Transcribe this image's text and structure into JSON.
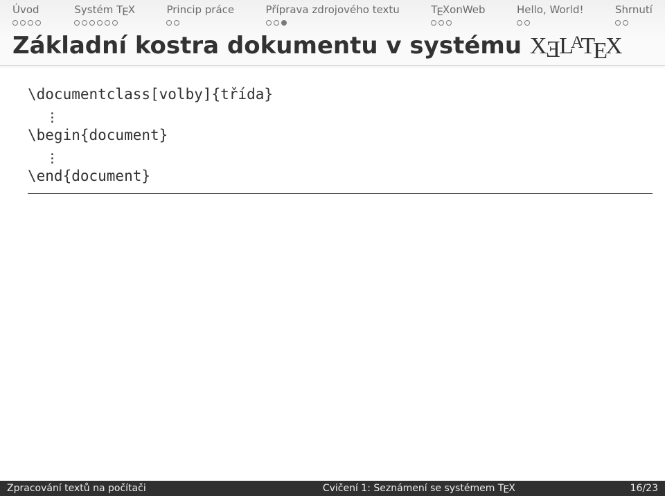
{
  "nav": {
    "items": [
      {
        "label": "Úvod",
        "total": 4,
        "current": -1
      },
      {
        "label_pre": "Systém T",
        "label_sub": "E",
        "label_post": "X",
        "total": 6,
        "current": -1
      },
      {
        "label": "Princip práce",
        "total": 2,
        "current": -1
      },
      {
        "label": "Příprava zdrojového textu",
        "total": 3,
        "current": 2
      },
      {
        "label_pre": "T",
        "label_sub": "E",
        "label_post": "XonWeb",
        "total": 3,
        "current": -1
      },
      {
        "label": "Hello, World!",
        "total": 2,
        "current": -1
      },
      {
        "label": "Shrnutí",
        "total": 2,
        "current": -1
      }
    ]
  },
  "title": {
    "text": "Základní kostra dokumentu v systému ",
    "logo_x1": "X",
    "logo_e1": "E",
    "logo_l": "L",
    "logo_a": "A",
    "logo_t": "T",
    "logo_e2": "E",
    "logo_x2": "X"
  },
  "code": {
    "line1": "\\documentclass[volby]{třída}",
    "line2": "\\begin{document}",
    "line3": "\\end{document}"
  },
  "footer": {
    "left": "Zpracování textů na počítači",
    "center_pre": "Cvičení 1: Seznámení se systémem T",
    "center_sub": "E",
    "center_post": "X",
    "page_current": "16",
    "page_sep": " / ",
    "page_total": "23"
  }
}
